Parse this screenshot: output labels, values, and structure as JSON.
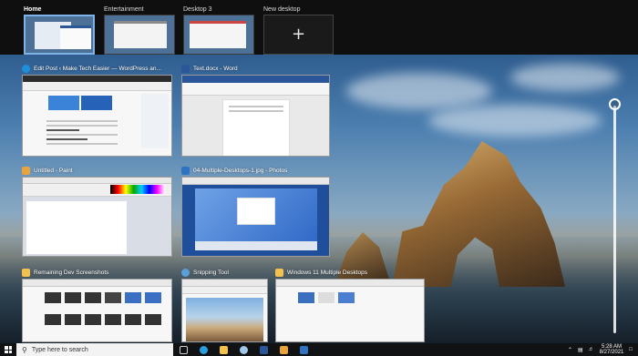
{
  "desktops": [
    {
      "label": "Home",
      "active": true
    },
    {
      "label": "Entertainment",
      "active": false
    },
    {
      "label": "Desktop 3",
      "active": false
    }
  ],
  "new_desktop": {
    "label": "New desktop",
    "icon": "plus-icon"
  },
  "windows": [
    {
      "title": "Edit Post ‹ Make Tech Easier — WordPress an...",
      "app": "edge",
      "icon_color": "#1e8fd8"
    },
    {
      "title": "Text.docx - Word",
      "app": "word",
      "icon_color": "#2b579a"
    },
    {
      "title": "Untitled - Paint",
      "app": "paint",
      "icon_color": "#e8a33d"
    },
    {
      "title": "04-Multiple-Desktops-1.jpg - Photos",
      "app": "photos",
      "icon_color": "#2f73c2"
    },
    {
      "title": "Remaining Dev Screenshots",
      "app": "explorer",
      "icon_color": "#f2c14e"
    },
    {
      "title": "Snipping Tool",
      "app": "snipping",
      "icon_color": "#5aa0d8"
    },
    {
      "title": "Windows 11 Multiple Desktops",
      "app": "explorer",
      "icon_color": "#f2c14e"
    }
  ],
  "taskbar": {
    "search_placeholder": "Type here to search",
    "time": "5:28 AM",
    "date": "8/27/2021",
    "apps": [
      {
        "name": "task-view-icon",
        "color": "#cfcfcf"
      },
      {
        "name": "edge-icon",
        "color": "#2a9de0"
      },
      {
        "name": "file-explorer-icon",
        "color": "#f2c14e"
      },
      {
        "name": "snipping-tool-icon",
        "color": "#9fc7ea"
      },
      {
        "name": "word-icon",
        "color": "#2b579a"
      },
      {
        "name": "paint-icon",
        "color": "#e8a33d"
      },
      {
        "name": "photos-icon",
        "color": "#2f73c2"
      }
    ]
  }
}
